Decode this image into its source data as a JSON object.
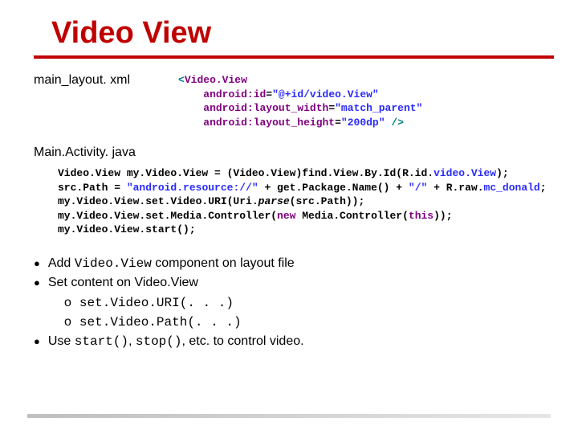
{
  "title": "Video View",
  "labels": {
    "xml": "main_layout. xml",
    "java": "Main.Activity. java"
  },
  "xml": {
    "l1a": "<",
    "l1b": "Video.View",
    "l2a": "android:",
    "l2b": "id",
    "l2c": "=",
    "l2d": "\"@+id/video.View\"",
    "l3a": "android:",
    "l3b": "layout_width",
    "l3c": "=",
    "l3d": "\"match_parent\"",
    "l4a": "android:",
    "l4b": "layout_height",
    "l4c": "=",
    "l4d": "\"200dp\"",
    "l4e": " />"
  },
  "java": {
    "l1a": "Video.View my.Video.View = (Video.View)find.View.By.Id(R.id.",
    "l1b": "video.View",
    "l1c": ");",
    "l2a": "src.Path = ",
    "l2b": "\"android.resource://\"",
    "l2c": " + get.Package.Name() + ",
    "l2d": "\"/\"",
    "l2e": " + R.raw.",
    "l2f": "mc_donald",
    "l2g": ";",
    "l3": "my.Video.View.set.Video.URI(Uri.",
    "l3b": "parse",
    "l3c": "(src.Path));",
    "l4a": "my.Video.View.set.Media.Controller(",
    "l4b": "new",
    "l4c": " Media.Controller(",
    "l4d": "this",
    "l4e": "));",
    "l5": "my.Video.View.start();"
  },
  "bullets": {
    "b1a": "Add ",
    "b1b": "Video.View",
    "b1c": " component on layout file",
    "b2": "Set content on Video.View",
    "b2s1": "set.Video.URI(. . .)",
    "b2s2": "set.Video.Path(. . .)",
    "b3a": "Use ",
    "b3b": "start()",
    "b3c": ", ",
    "b3d": "stop()",
    "b3e": ", etc. to control video."
  }
}
